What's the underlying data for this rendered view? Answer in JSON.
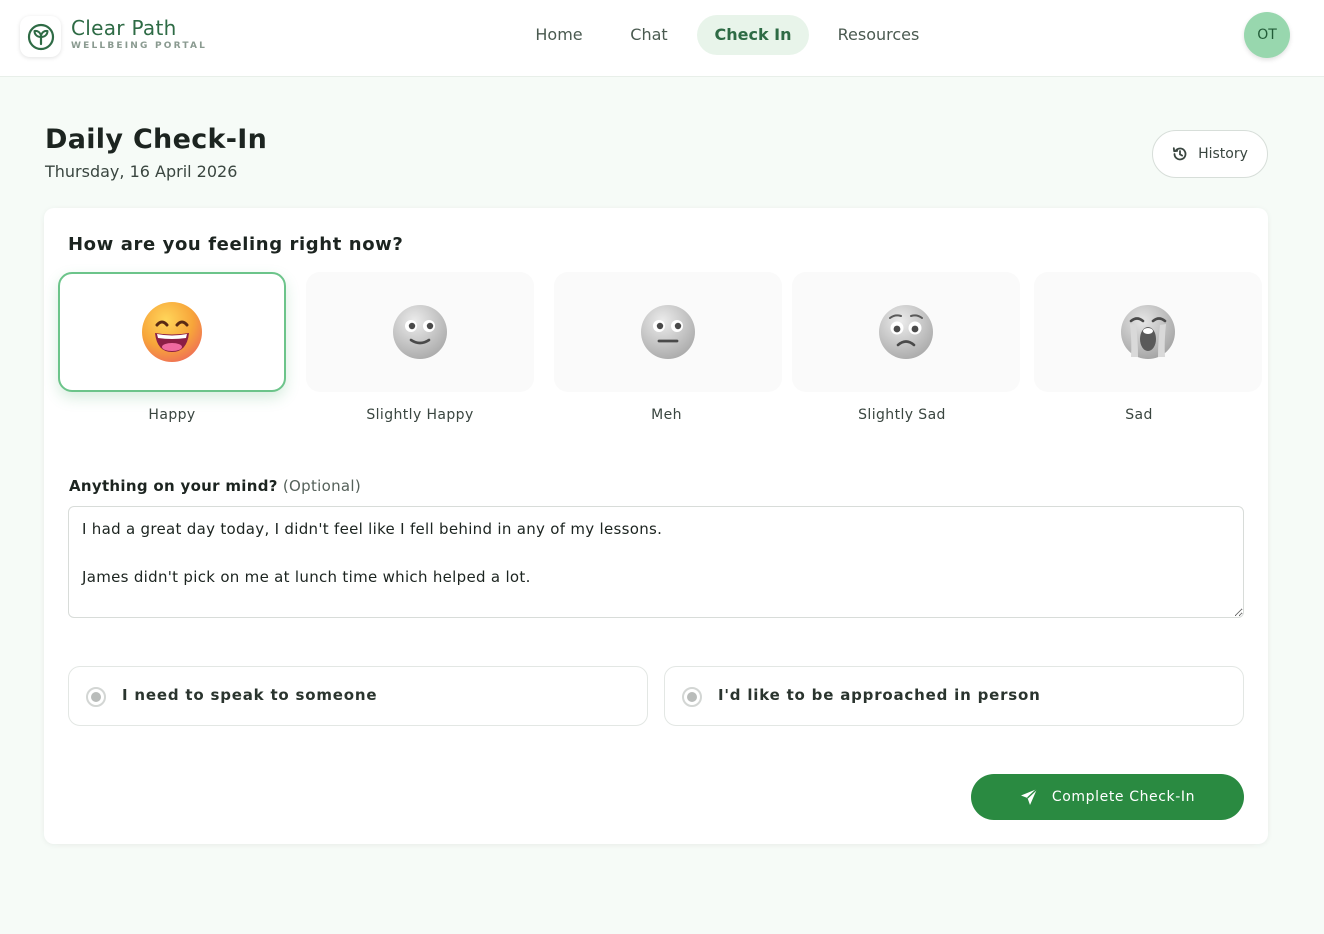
{
  "header": {
    "brand_name": "Clear Path",
    "brand_subtitle": "WELLBEING PORTAL",
    "nav": [
      {
        "label": "Home"
      },
      {
        "label": "Chat"
      },
      {
        "label": "Check In"
      },
      {
        "label": "Resources"
      }
    ],
    "active_nav": "Check In",
    "avatar_initials": "OT"
  },
  "page": {
    "title": "Daily Check-In",
    "date": "Thursday, 16 April 2026",
    "history_label": "History"
  },
  "checkin": {
    "question": "How are you feeling right now?",
    "moods": [
      {
        "label": "Happy",
        "icon": "grinning-face-icon",
        "selected": true
      },
      {
        "label": "Slightly Happy",
        "icon": "slightly-smiling-face-icon",
        "selected": false
      },
      {
        "label": "Meh",
        "icon": "neutral-face-icon",
        "selected": false
      },
      {
        "label": "Slightly Sad",
        "icon": "worried-face-icon",
        "selected": false
      },
      {
        "label": "Sad",
        "icon": "crying-face-icon",
        "selected": false
      }
    ],
    "mind_label": "Anything on your mind?",
    "mind_optional": "(Optional)",
    "notes_value": "I had a great day today, I didn't feel like I fell behind in any of my lessons.\n\nJames didn't pick on me at lunch time which helped a lot.",
    "options": [
      {
        "label": "I need to speak to someone"
      },
      {
        "label": "I'd like to be approached in person"
      }
    ],
    "submit_label": "Complete Check-In"
  },
  "colors": {
    "brand": "#2e6b45",
    "accent": "#2a8a41",
    "selected_border": "#6cc48a",
    "avatar_bg": "#98d7ae",
    "page_bg": "#f6fbf7"
  }
}
